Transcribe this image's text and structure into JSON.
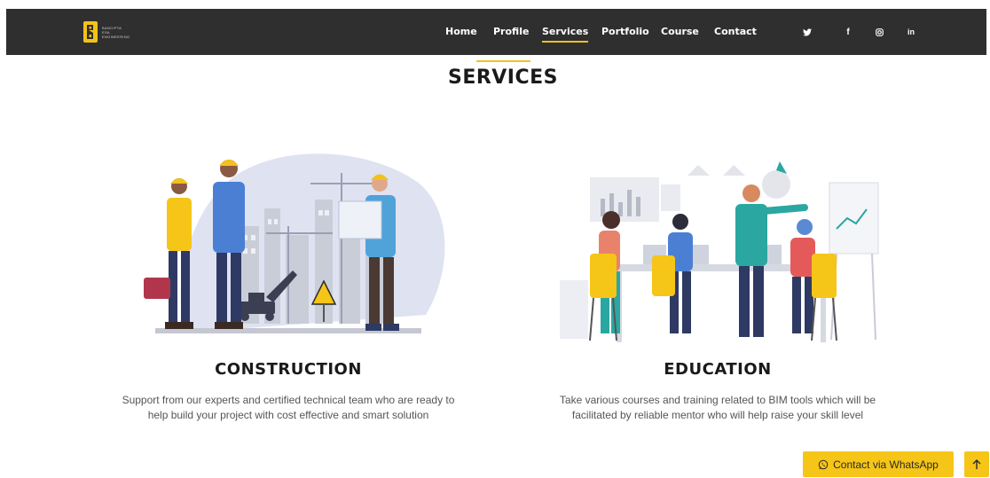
{
  "brand": {
    "lines": [
      "BANCIPTA",
      "ESA",
      "ENGINEERING"
    ],
    "accent": "#f2c21b",
    "nav_bg": "#2f2f2f"
  },
  "nav": {
    "items": [
      {
        "label": "Home",
        "active": false
      },
      {
        "label": "Profile",
        "active": false
      },
      {
        "label": "Services",
        "active": true
      },
      {
        "label": "Portfolio",
        "active": false
      },
      {
        "label": "Course",
        "active": false
      },
      {
        "label": "Contact",
        "active": false
      }
    ],
    "social": [
      {
        "icon": "twitter-icon",
        "glyph": "🐦"
      },
      {
        "icon": "facebook-icon",
        "glyph": "f"
      },
      {
        "icon": "instagram-icon",
        "glyph": "◎"
      },
      {
        "icon": "linkedin-icon",
        "glyph": "in"
      }
    ]
  },
  "page": {
    "title": "SERVICES"
  },
  "services": [
    {
      "title": "CONSTRUCTION",
      "description_line1": "Support from our experts and certified technical team who are ready to",
      "description_line2": "help build your project with cost effective and smart solution",
      "illustration": "construction-workers-illustration"
    },
    {
      "title": "EDUCATION",
      "description_line1": "Take various courses and training related to BIM tools which will be",
      "description_line2": "facilitated by reliable mentor who will help raise your skill level",
      "illustration": "classroom-meeting-illustration"
    }
  ],
  "floating": {
    "whatsapp_label": "Contact via WhatsApp",
    "whatsapp_icon": "whatsapp-icon",
    "back_to_top_icon": "arrow-up-icon"
  }
}
